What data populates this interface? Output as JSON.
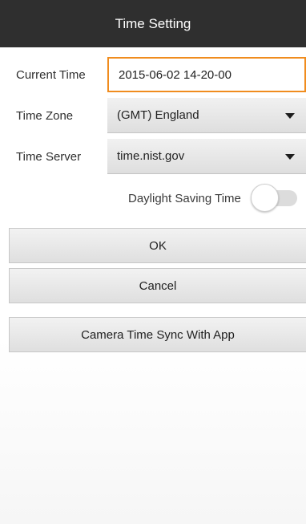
{
  "header": {
    "title": "Time Setting"
  },
  "form": {
    "current_time_label": "Current Time",
    "current_time_value": "2015-06-02 14-20-00",
    "time_zone_label": "Time Zone",
    "time_zone_value": "(GMT) England",
    "time_server_label": "Time Server",
    "time_server_value": "time.nist.gov",
    "dst_label": "Daylight Saving Time",
    "dst_enabled": false
  },
  "buttons": {
    "ok_label": "OK",
    "cancel_label": "Cancel",
    "sync_label": "Camera Time Sync With App"
  },
  "colors": {
    "header_bg": "#2f2f2f",
    "input_focus_border": "#f08c1e"
  }
}
